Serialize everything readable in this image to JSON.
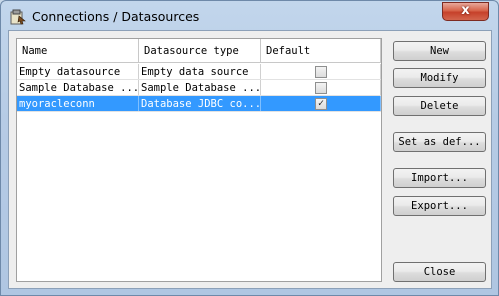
{
  "window": {
    "title": "Connections / Datasources",
    "close_label": "x"
  },
  "table": {
    "columns": [
      "Name",
      "Datasource type",
      "Default"
    ],
    "rows": [
      {
        "name": "Empty datasource",
        "type": "Empty data source",
        "default": false,
        "selected": false
      },
      {
        "name": "Sample Database ...",
        "type": "Sample Database ...",
        "default": false,
        "selected": false
      },
      {
        "name": "myoracleconn",
        "type": "Database JDBC co...",
        "default": true,
        "selected": true
      }
    ]
  },
  "buttons": {
    "new": "New",
    "modify": "Modify",
    "delete": "Delete",
    "set_default": "Set as def...",
    "import": "Import...",
    "export": "Export...",
    "close": "Close"
  },
  "colors": {
    "selection": "#3399ff",
    "title_close": "#c6412a"
  }
}
